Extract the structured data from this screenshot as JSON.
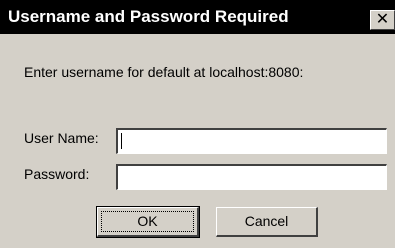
{
  "window": {
    "title": "Username and Password Required",
    "close_glyph": "✕"
  },
  "prompt": "Enter username for default at localhost:8080:",
  "form": {
    "username_label": "User Name:",
    "username_value": "",
    "password_label": "Password:",
    "password_value": ""
  },
  "buttons": {
    "ok_label": "OK",
    "cancel_label": "Cancel"
  },
  "colors": {
    "titlebar": "#000000",
    "title_text": "#ffffff",
    "dialog_bg": "#d4d0c8",
    "field_bg": "#ffffff"
  }
}
